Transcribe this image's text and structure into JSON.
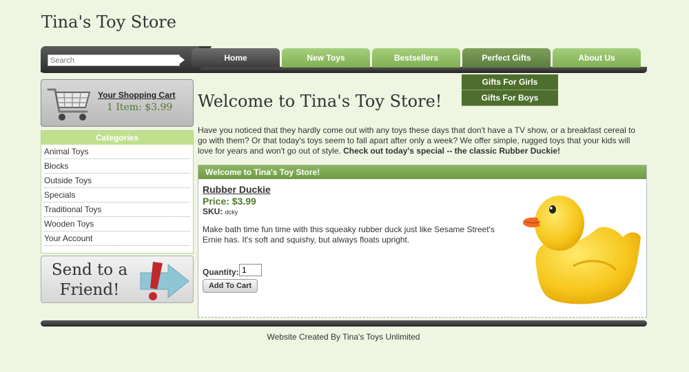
{
  "site": {
    "title": "Tina's Toy Store"
  },
  "search": {
    "placeholder": "Search"
  },
  "nav": {
    "tabs": [
      {
        "label": "Home"
      },
      {
        "label": "New Toys"
      },
      {
        "label": "Bestsellers"
      },
      {
        "label": "Perfect Gifts"
      },
      {
        "label": "About Us"
      }
    ],
    "active_tab": "Perfect Gifts",
    "dropdown": [
      {
        "label": "Gifts For Girls"
      },
      {
        "label": "Gifts For Boys"
      }
    ]
  },
  "cart": {
    "link_label": "Your Shopping Cart",
    "summary": "1 Item: $3.99"
  },
  "categories": {
    "heading": "Categories",
    "items": [
      {
        "label": "Animal Toys"
      },
      {
        "label": "Blocks"
      },
      {
        "label": "Outside Toys"
      },
      {
        "label": "Specials"
      },
      {
        "label": "Traditional Toys"
      },
      {
        "label": "Wooden Toys"
      },
      {
        "label": "Your Account"
      }
    ]
  },
  "send_friend": {
    "line1": "Send to a",
    "line2": "Friend!"
  },
  "main": {
    "heading": "Welcome to Tina's Toy Store!",
    "intro": "Have you noticed that they hardly come out with any toys these days that don't have a TV show, or a breakfast cereal to go with them? Or that today's toys seem to fall apart after only a week? We offer simple, rugged toys that your kids will love for years and won't go out of style.",
    "intro_bold": "Check out today's special -- the classic Rubber Duckie!"
  },
  "product_panel": {
    "heading": "Welcome to Tina's Toy Store!",
    "name": "Rubber Duckie",
    "price": "Price: $3.99",
    "sku_label": "SKU:",
    "sku_value": "dcky",
    "description": "Make bath time fun time with this squeaky rubber duck just like Sesame Street's Ernie has. It's soft and squishy, but always floats upright.",
    "quantity_label": "Quantity:",
    "quantity_value": "1",
    "add_button": "Add To Cart"
  },
  "footer": {
    "text": "Website Created By Tina's Toys Unlimited"
  },
  "colors": {
    "background": "#eef6e2",
    "accent_green": "#7faf52",
    "dark_green": "#4e6e2d",
    "price_green": "#4f7a2d"
  }
}
